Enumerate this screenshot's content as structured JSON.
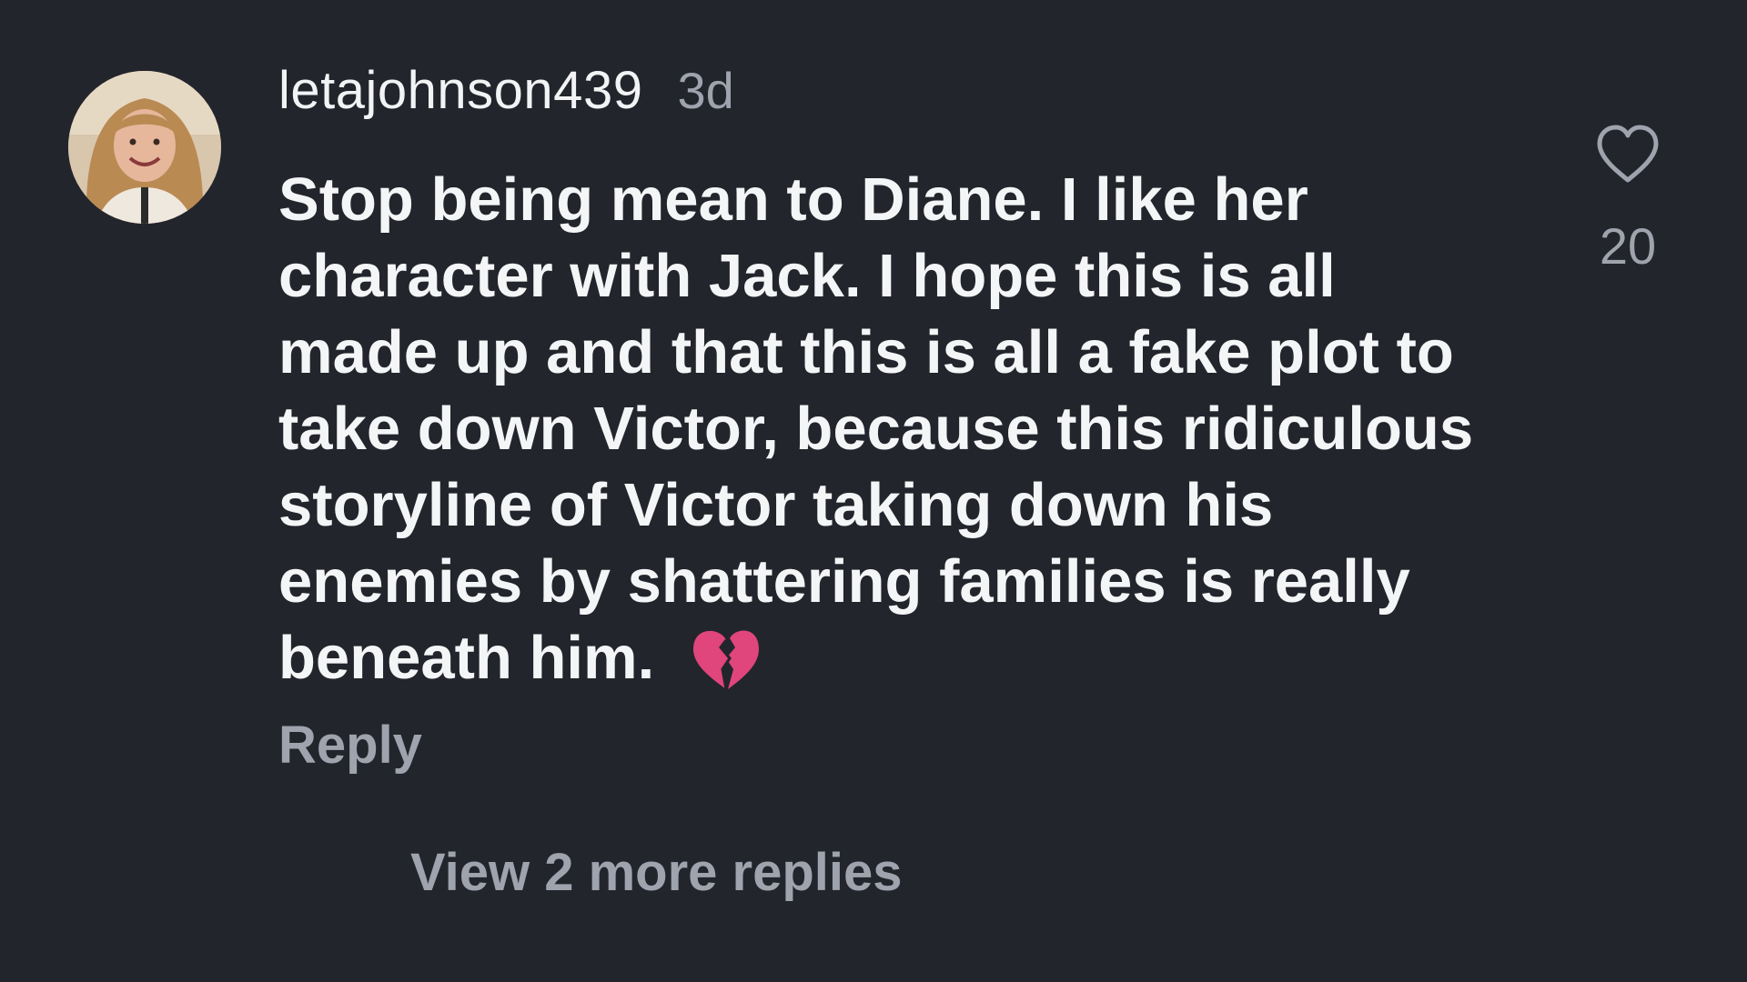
{
  "comment": {
    "username": "letajohnson439",
    "timestamp": "3d",
    "text": "Stop being mean to Diane. I like her character with Jack. I hope this is all made up and that this is all a fake plot to take down Victor, because this ridiculous storyline of Victor taking down his enemies by shattering families is really beneath him.",
    "emoji_icon": "broken-heart-icon",
    "reply_label": "Reply",
    "like_icon": "heart-outline-icon",
    "like_count": "20",
    "view_more_label": "View 2 more replies"
  },
  "colors": {
    "background": "#23252c",
    "primary_text": "#f4f5f7",
    "secondary_text": "#9ea3ad",
    "emoji": "#e0457b"
  }
}
